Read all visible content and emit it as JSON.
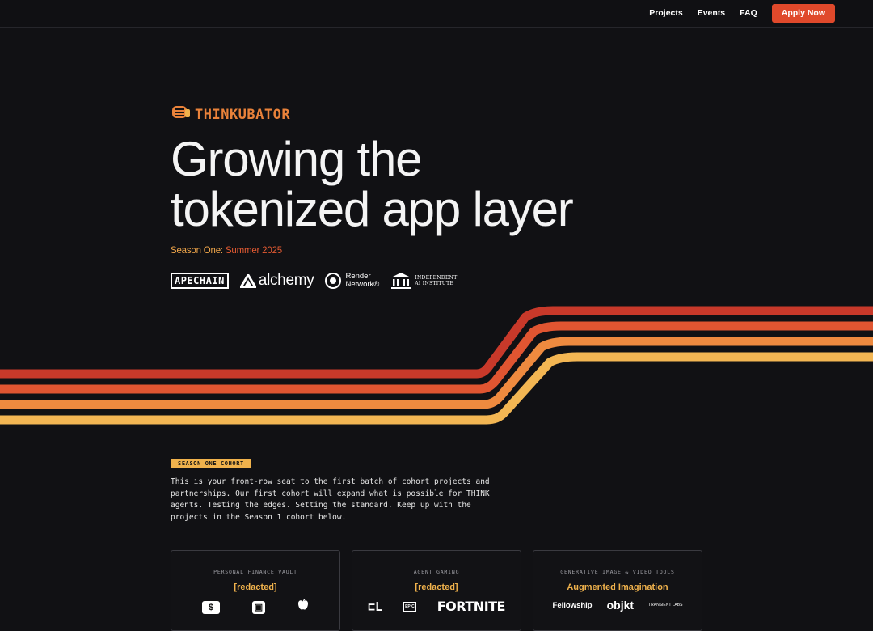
{
  "nav": {
    "links": [
      "Projects",
      "Events",
      "FAQ"
    ],
    "apply_label": "Apply Now"
  },
  "brand": {
    "wordmark": "THINKUBATOR",
    "icon": "fist-icon"
  },
  "hero": {
    "title_line1": "Growing the",
    "title_line2": "tokenized app layer",
    "season_key": "Season One:",
    "season_value": "Summer 2025"
  },
  "partners": {
    "apechain": "APECHAIN",
    "alchemy": "alchemy",
    "render_line1": "Render",
    "render_line2": "Network®",
    "iai_line1": "INDEPENDENT",
    "iai_line2": "AI INSTITUTE"
  },
  "cohort": {
    "badge": "SEASON ONE COHORT",
    "intro": "This is your front-row seat to the first batch of cohort projects and partnerships. Our first cohort will expand what is possible for THINK agents. Testing the edges. Setting the standard. Keep up with the projects in the Season 1 cohort below."
  },
  "cards": [
    {
      "category": "PERSONAL FINANCE VAULT",
      "name": "[redacted]",
      "logos": [
        "$",
        "▣",
        ""
      ]
    },
    {
      "category": "AGENT GAMING",
      "name": "[redacted]",
      "logos": [
        "⊏L",
        "EPIC",
        "FORTNITE"
      ]
    },
    {
      "category": "GENERATIVE IMAGE & VIDEO TOOLS",
      "name": "Augmented Imagination",
      "logos": [
        "Fellowship",
        "objkt",
        "TRANSIENT LABS"
      ]
    }
  ],
  "colors": {
    "accent": "#e0492b",
    "stripe1": "#c8392a",
    "stripe2": "#e05531",
    "stripe3": "#ee8a3f",
    "stripe4": "#f3b653"
  }
}
